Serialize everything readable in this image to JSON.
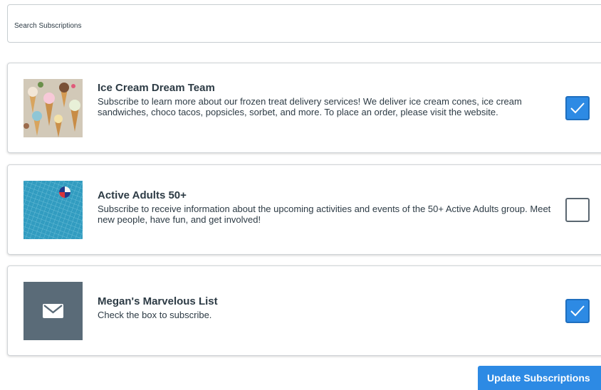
{
  "search": {
    "placeholder": "Search Subscriptions"
  },
  "subscriptions": [
    {
      "title": "Ice Cream Dream Team",
      "description": "Subscribe to learn more about our frozen treat delivery services! We deliver ice cream cones, ice cream sandwiches, choco tacos, popsicles, sorbet, and more. To place an order, please visit the website.",
      "subscribed": true,
      "image": "ice-cream-cones-photo"
    },
    {
      "title": "Active Adults 50+",
      "description": "Subscribe to receive information about the upcoming activities and events of the 50+ Active Adults group. Meet new people, have fun, and get involved!",
      "subscribed": false,
      "image": "pool-beach-ball-photo"
    },
    {
      "title": "Megan's Marvelous List",
      "description": "Check the box to subscribe.",
      "subscribed": true,
      "image": "envelope-icon"
    }
  ],
  "actions": {
    "update_label": "Update Subscriptions"
  },
  "colors": {
    "accent": "#2d8ae4",
    "text": "#2d3b45",
    "placeholder_tile": "#5a6b78"
  }
}
